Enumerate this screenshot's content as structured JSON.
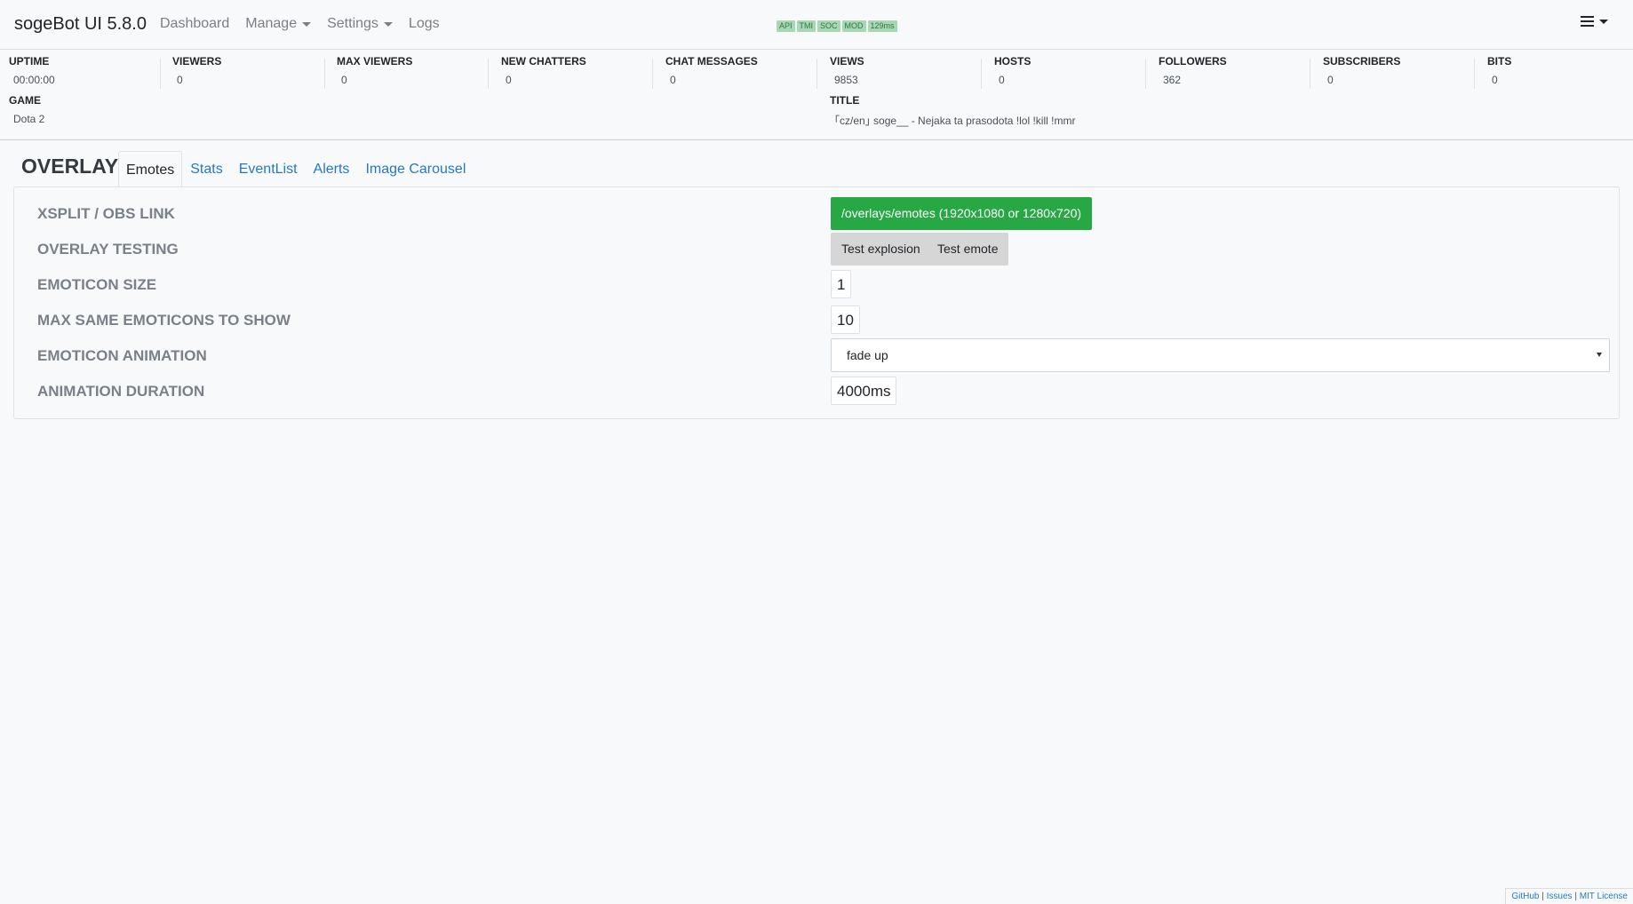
{
  "navbar": {
    "brand": "sogeBot UI 5.8.0",
    "links": [
      "Dashboard",
      "Manage",
      "Settings",
      "Logs"
    ],
    "badges": [
      "API",
      "TMI",
      "SOC",
      "MOD",
      "129ms"
    ],
    "status_color": "#a9d6b3"
  },
  "stats": {
    "uptime": {
      "label": "UPTIME",
      "value": "00:00:00"
    },
    "viewers": {
      "label": "VIEWERS",
      "value": "0"
    },
    "max_viewers": {
      "label": "MAX VIEWERS",
      "value": "0"
    },
    "new_chatters": {
      "label": "NEW CHATTERS",
      "value": "0"
    },
    "chat_messages": {
      "label": "CHAT MESSAGES",
      "value": "0"
    },
    "views": {
      "label": "VIEWS",
      "value": "9853"
    },
    "hosts": {
      "label": "HOSTS",
      "value": "0"
    },
    "followers": {
      "label": "FOLLOWERS",
      "value": "362"
    },
    "subscribers": {
      "label": "SUBSCRIBERS",
      "value": "0"
    },
    "bits": {
      "label": "BITS",
      "value": "0"
    },
    "game": {
      "label": "GAME",
      "value": "Dota 2"
    },
    "title": {
      "label": "TITLE",
      "value": "｢cz/en｣ soge__ - Nejaka ta prasodota !lol !kill !mmr"
    }
  },
  "page": {
    "title": "OVERLAYS",
    "tabs": [
      "Emotes",
      "Stats",
      "EventList",
      "Alerts",
      "Image Carousel"
    ],
    "active_tab": "Emotes"
  },
  "settings": {
    "link_label": "XSPLIT / OBS LINK",
    "link_button": "/overlays/emotes (1920x1080 or 1280x720)",
    "testing_label": "OVERLAY TESTING",
    "test_explosion": "Test explosion",
    "test_emote": "Test emote",
    "size_label": "EMOTICON SIZE",
    "size_value": "1",
    "max_label": "MAX SAME EMOTICONS TO SHOW",
    "max_value": "10",
    "animation_label": "EMOTICON ANIMATION",
    "animation_value": "fade up",
    "duration_label": "ANIMATION DURATION",
    "duration_value": "4000ms"
  },
  "footer": {
    "github": "GitHub",
    "issues": "Issues",
    "license": "MIT License",
    "separator": "|"
  },
  "colors": {
    "accent": "#2479c6",
    "success": "#28a745"
  }
}
